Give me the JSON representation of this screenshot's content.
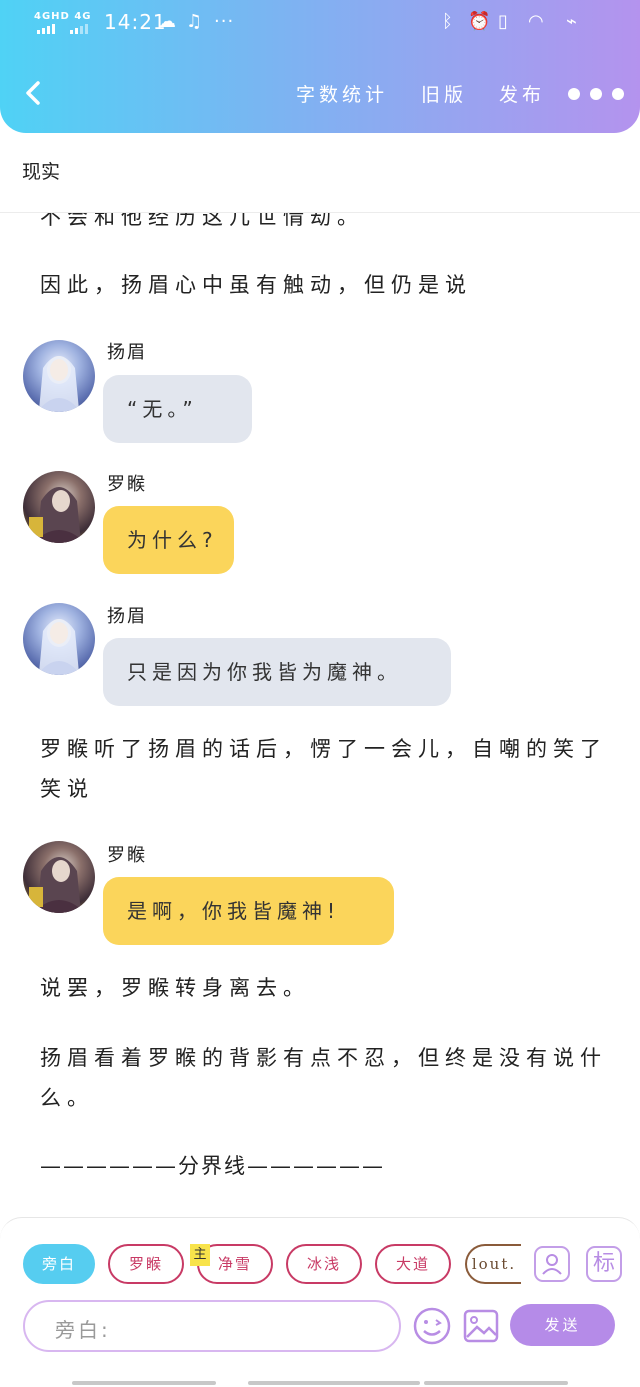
{
  "status_bar": {
    "network": "4GHD 4G",
    "time": "14:21"
  },
  "toolbar": {
    "word_count": "字数统计",
    "old_version": "旧版",
    "publish": "发布"
  },
  "chapter": {
    "title": "现实"
  },
  "content": {
    "paragraphs": [
      "不会和他经历这几世情劫。",
      "因此，扬眉心中虽有触动，但仍是说",
      "罗睺听了扬眉的话后，愣了一会儿，自嘲的笑了笑说",
      "说罢，罗睺转身离去。",
      "扬眉看着罗睺的背影有点不忍，但终是没有说什么。",
      "——————分界线——————"
    ],
    "messages": [
      {
        "speaker": "扬眉",
        "text": "“无。”"
      },
      {
        "speaker": "罗睺",
        "text": "为什么?"
      },
      {
        "speaker": "扬眉",
        "text": "只是因为你我皆为魔神。"
      },
      {
        "speaker": "罗睺",
        "text": "是啊，你我皆魔神!"
      }
    ]
  },
  "composer": {
    "roles": [
      "旁白",
      "罗睺",
      "净雪",
      "冰浅",
      "大道",
      "lout."
    ],
    "main_tag": "主",
    "mark_button": "标",
    "input_placeholder": "旁白:",
    "send_label": "发送"
  },
  "colors": {
    "header_start": "#4fd2f5",
    "header_end": "#b493ee",
    "bubble_gray": "#e2e6ee",
    "bubble_yellow": "#fbd55b",
    "send": "#b58be8",
    "active_chip": "#56cdf0",
    "chip_pink": "#c83a65"
  }
}
